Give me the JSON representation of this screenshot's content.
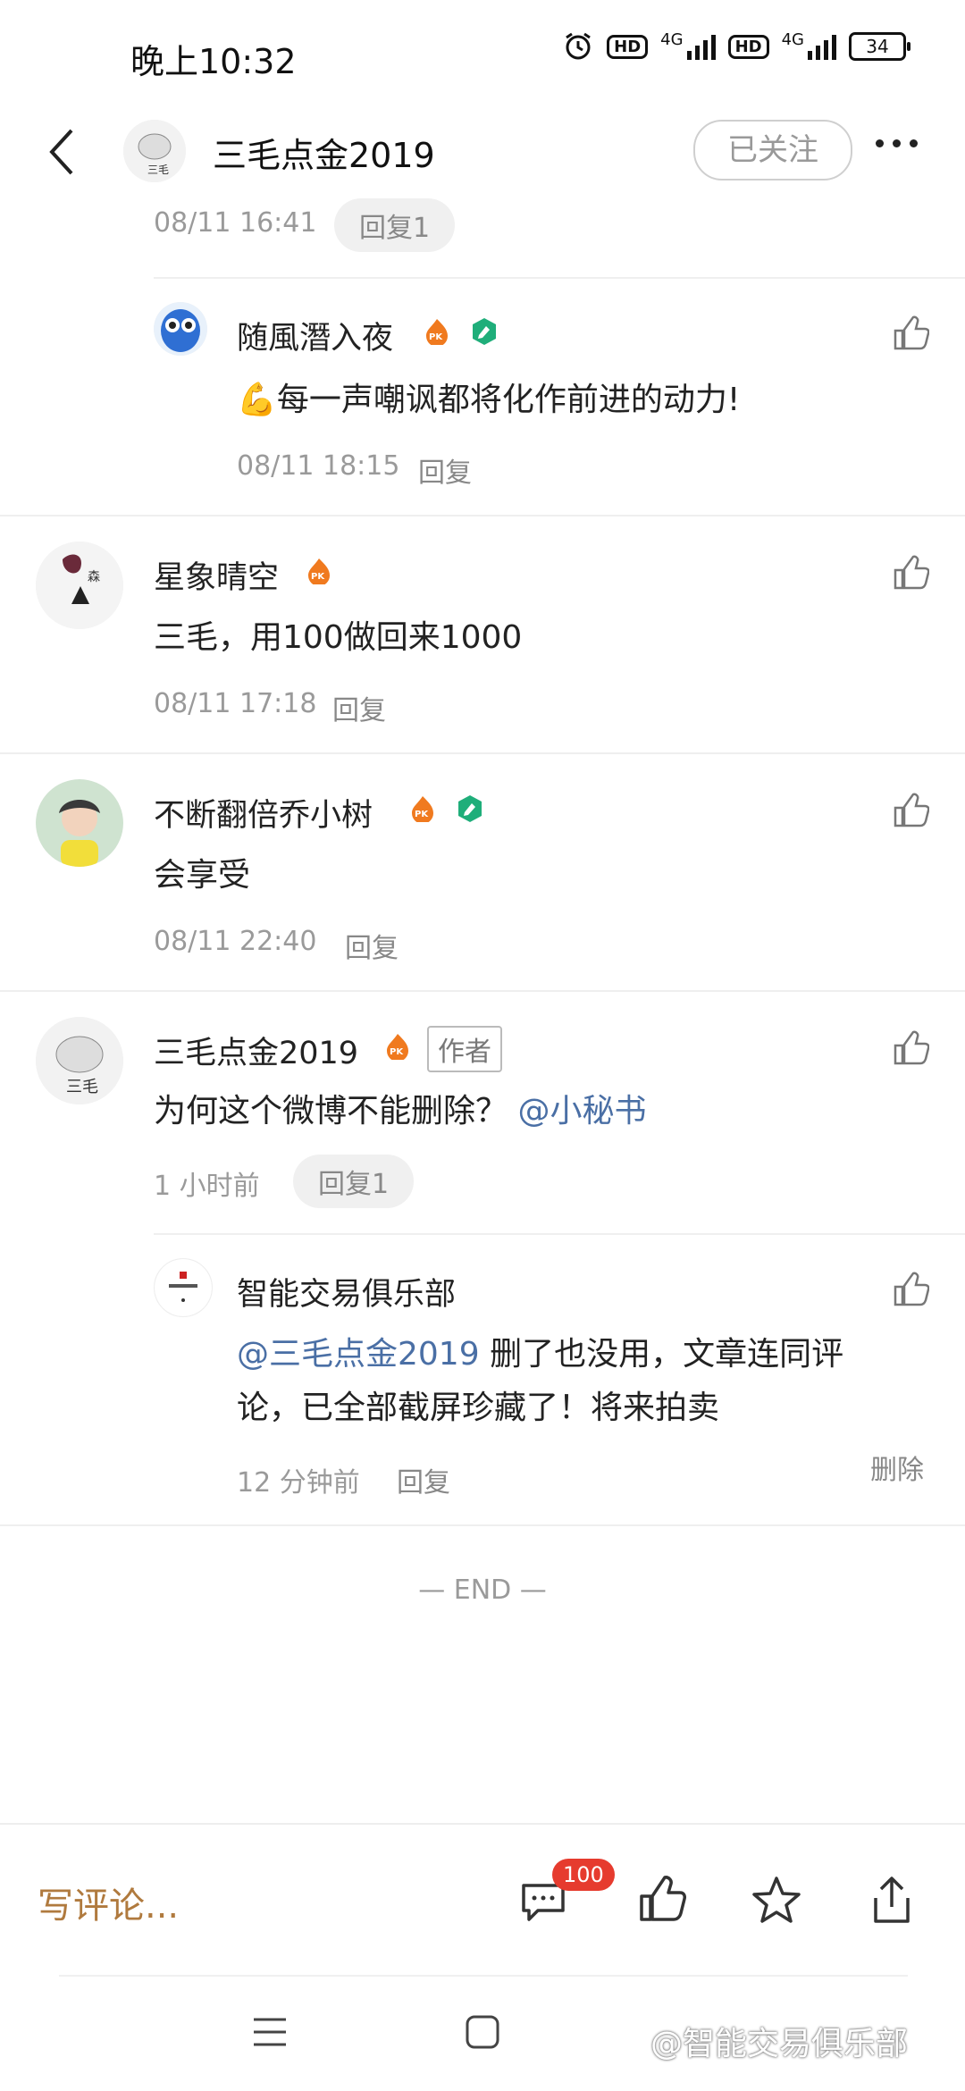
{
  "status_bar": {
    "time": "晚上10:32",
    "network": "4G",
    "hd_label": "HD",
    "battery": "34"
  },
  "header": {
    "title": "三毛点金2019",
    "follow_label": "已关注"
  },
  "comments": [
    {
      "partial_time": "08/11 16:41",
      "partial_reply": "回复1"
    },
    {
      "name": "随風潛入夜",
      "text": "每一声嘲讽都将化作前进的动力!",
      "emoji": "💪",
      "time": "08/11 18:15",
      "reply": "回复"
    },
    {
      "name": "星象晴空",
      "text": "三毛，用100做回来1000",
      "time": "08/11 17:18",
      "reply": "回复"
    },
    {
      "name": "不断翻倍乔小树",
      "text": "会享受",
      "time": "08/11 22:40",
      "reply": "回复"
    },
    {
      "name": "三毛点金2019",
      "author_tag": "作者",
      "text": "为何这个微博不能删除？",
      "mention": "@小秘书",
      "time": "1 小时前",
      "reply": "回复1"
    },
    {
      "name": "智能交易俱乐部",
      "mention": "@三毛点金2019",
      "text_line1": " 删了也没用，文章连同评",
      "text_line2": "论，已全部截屏珍藏了！将来拍卖",
      "time": "12 分钟前",
      "reply": "回复",
      "delete": "删除"
    }
  ],
  "end_marker": "— END —",
  "bottom_bar": {
    "write_comment": "写评论...",
    "comment_count": "100"
  },
  "watermark": "@智能交易俱乐部",
  "colors": {
    "accent": "#b07a3e",
    "mention": "#4a6fa5",
    "badge": "#e63b2e"
  },
  "icons": [
    "back-icon",
    "more-icon",
    "thumb-up-icon",
    "comment-icon",
    "star-icon",
    "share-icon",
    "menu-icon",
    "home-icon"
  ]
}
